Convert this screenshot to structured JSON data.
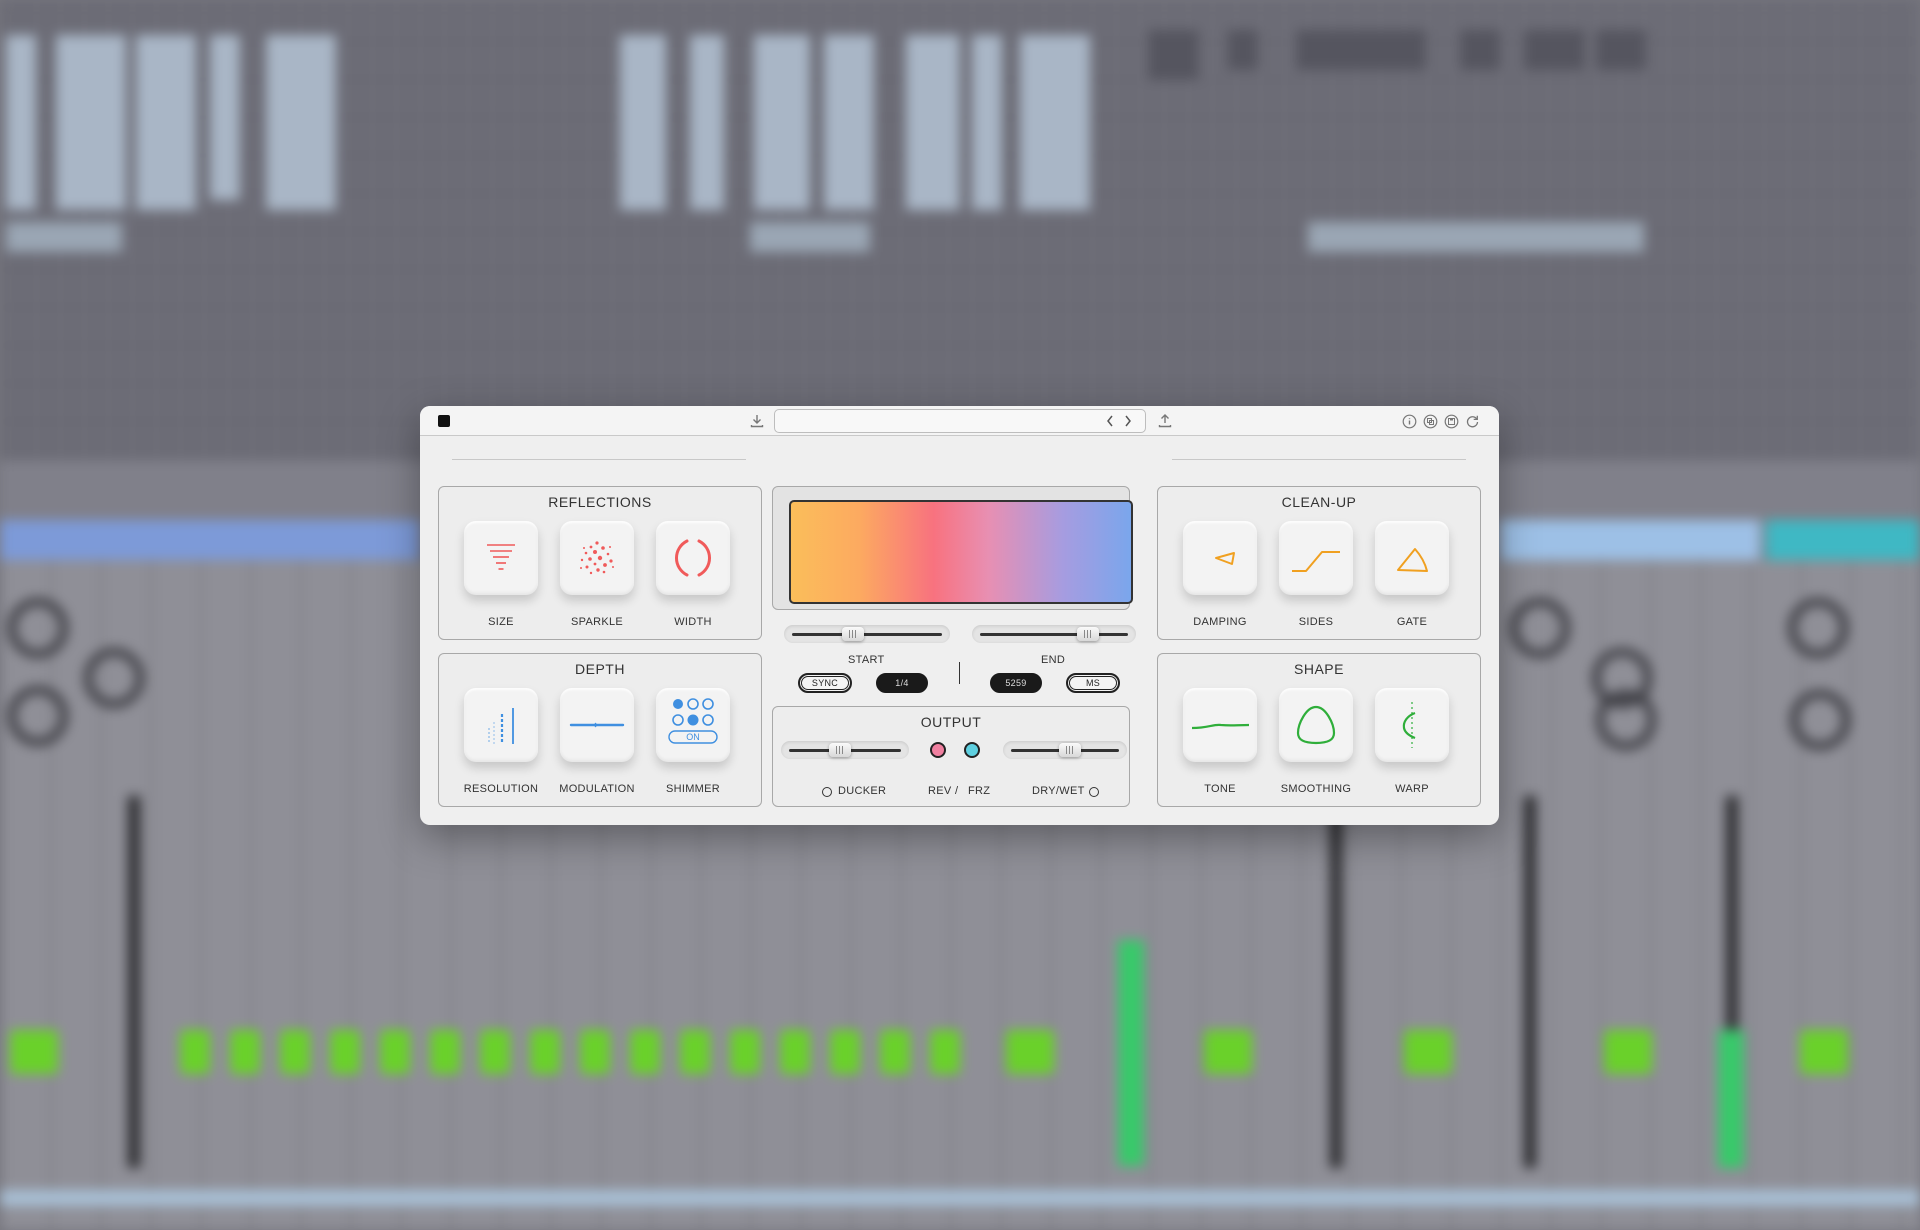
{
  "plugin": {
    "preset_name": "",
    "reflections": {
      "title": "REFLECTIONS",
      "controls": [
        {
          "label": "SIZE",
          "icon": "size-icon"
        },
        {
          "label": "SPARKLE",
          "icon": "sparkle-icon"
        },
        {
          "label": "WIDTH",
          "icon": "width-icon"
        }
      ],
      "accent": "#f05a5a"
    },
    "depth": {
      "title": "DEPTH",
      "controls": [
        {
          "label": "RESOLUTION",
          "icon": "resolution-icon"
        },
        {
          "label": "MODULATION",
          "icon": "modulation-icon"
        },
        {
          "label": "SHIMMER",
          "icon": "shimmer-icon",
          "badge": "ON"
        }
      ],
      "accent": "#3f8fe0"
    },
    "cleanup": {
      "title": "CLEAN-UP",
      "controls": [
        {
          "label": "DAMPING",
          "icon": "damping-icon"
        },
        {
          "label": "SIDES",
          "icon": "sides-icon"
        },
        {
          "label": "GATE",
          "icon": "gate-icon"
        }
      ],
      "accent": "#f0a020"
    },
    "shape": {
      "title": "SHAPE",
      "controls": [
        {
          "label": "TONE",
          "icon": "tone-icon"
        },
        {
          "label": "SMOOTHING",
          "icon": "smoothing-icon"
        },
        {
          "label": "WARP",
          "icon": "warp-icon"
        }
      ],
      "accent": "#2fae3a"
    },
    "timing": {
      "start_label": "START",
      "end_label": "END",
      "start_value": 0.4,
      "end_value": 0.75,
      "sync_label": "SYNC",
      "division": "1/4",
      "ms_value": "5259",
      "ms_label": "MS"
    },
    "output": {
      "title": "OUTPUT",
      "ducker_label": "DUCKER",
      "rev_label": "REV",
      "slash": "/",
      "frz_label": "FRZ",
      "drywet_label": "DRY/WET",
      "ducker_value": 0.45,
      "drywet_value": 0.55,
      "rev_color": "#f080a0",
      "frz_color": "#5fd0e0"
    }
  }
}
